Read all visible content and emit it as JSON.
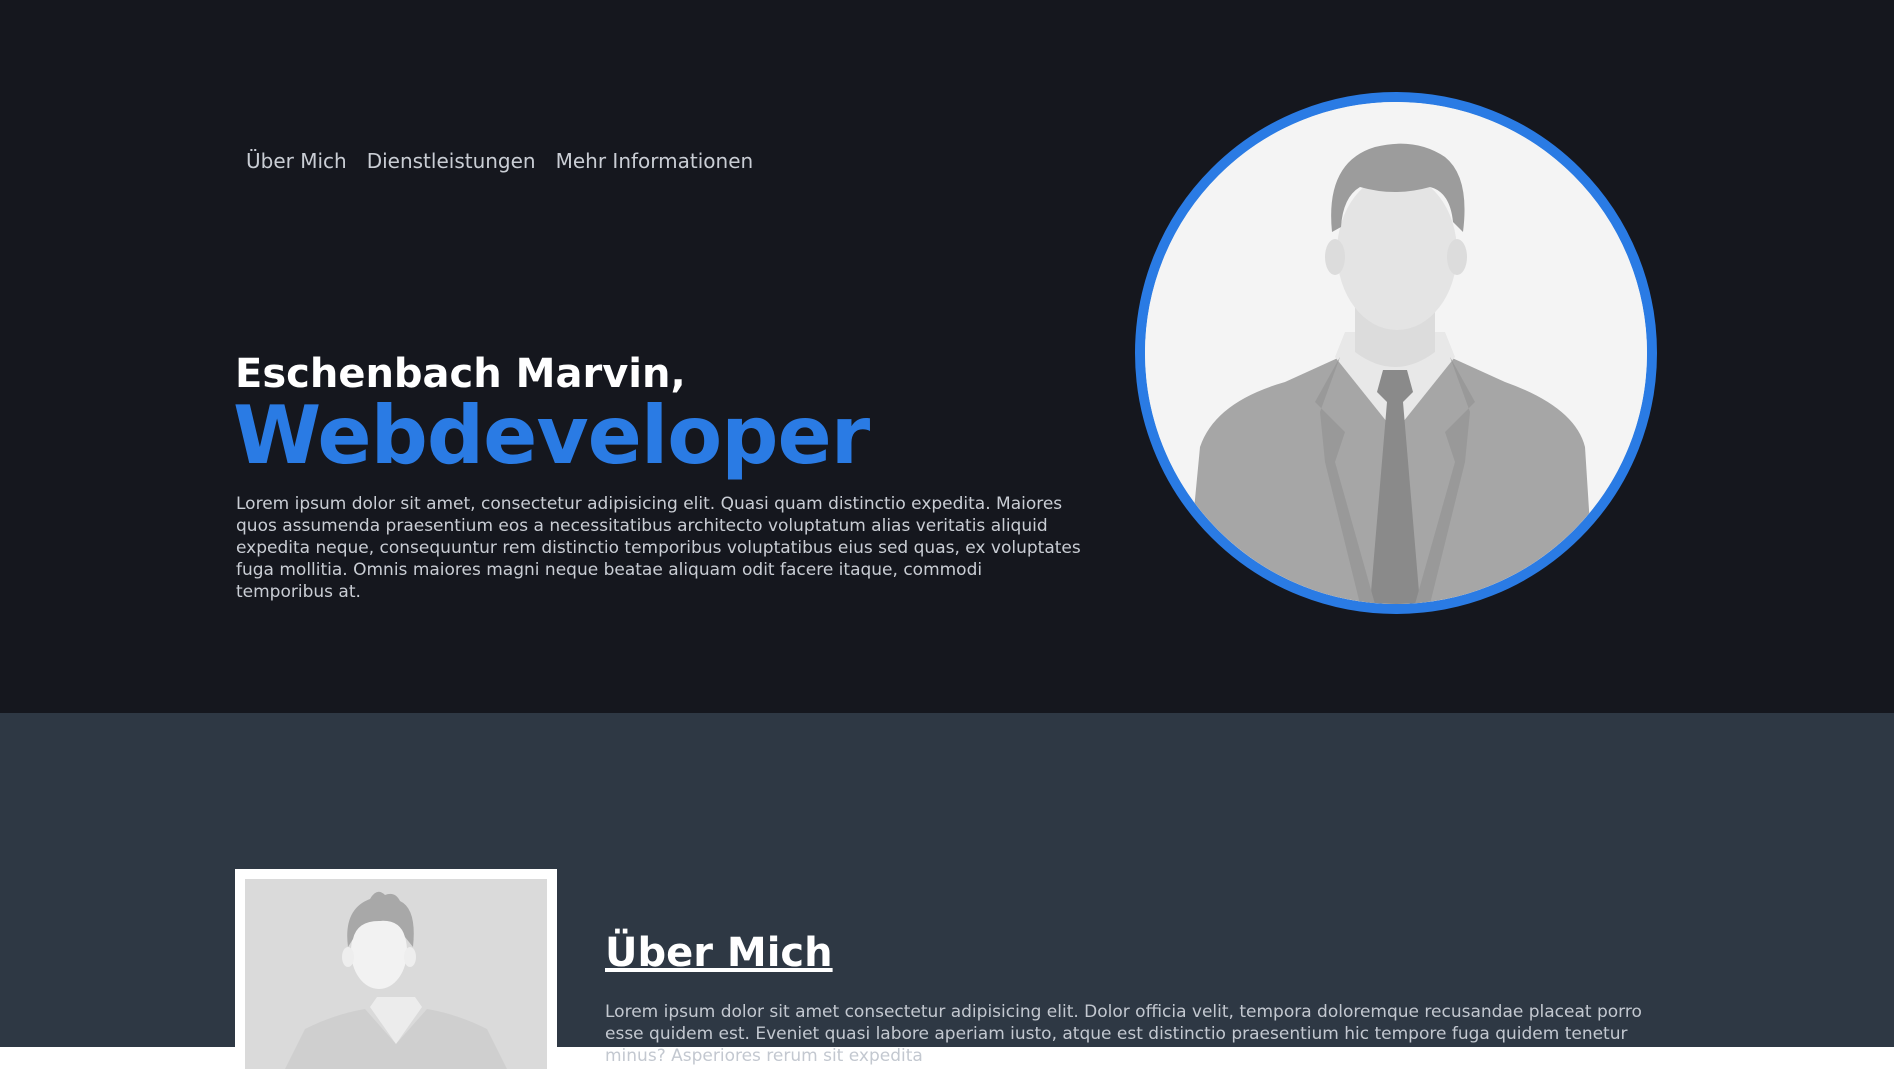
{
  "nav": {
    "items": [
      {
        "label": "Über Mich"
      },
      {
        "label": "Dienstleistungen"
      },
      {
        "label": "Mehr Informationen"
      }
    ]
  },
  "hero": {
    "name": "Eschenbach Marvin,",
    "role": "Webdeveloper",
    "text": "Lorem ipsum dolor sit amet, consectetur adipisicing elit. Quasi quam distinctio expedita. Maiores quos assumenda praesentium eos a necessitatibus architecto voluptatum alias veritatis aliquid expedita neque, consequuntur rem distinctio temporibus voluptatibus eius sed quas, ex voluptates fuga mollitia. Omnis maiores magni neque beatae aliquam odit facere itaque, commodi temporibus at.",
    "avatar_icon": "person-placeholder-icon"
  },
  "about": {
    "title": "Über Mich",
    "text": "Lorem ipsum dolor sit amet consectetur adipisicing elit. Dolor officia velit, tempora doloremque recusandae placeat porro esse quidem est. Eveniet quasi labore aperiam iusto, atque est distinctio praesentium hic tempore fuga quidem tenetur minus? Asperiores rerum sit expedita",
    "photo_icon": "person-placeholder-icon"
  },
  "colors": {
    "accent": "#2a7be4",
    "hero_bg": "#15171e",
    "about_bg": "#2e3844"
  }
}
